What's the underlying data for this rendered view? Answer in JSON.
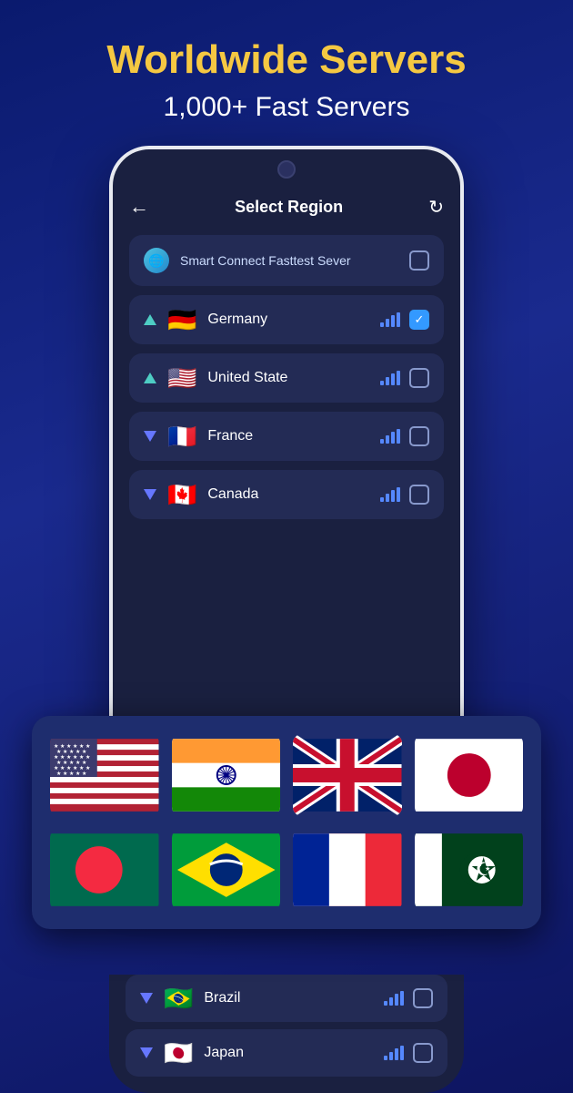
{
  "header": {
    "title_line1": "Worldwide Servers",
    "subtitle": "1,000+ Fast Servers"
  },
  "phone": {
    "screen_title": "Select Region",
    "back_label": "←",
    "refresh_label": "↻"
  },
  "servers": [
    {
      "id": "smart",
      "name": "Smart Connect Fasttest Sever",
      "type": "smart",
      "checked": false
    },
    {
      "id": "germany",
      "name": "Germany",
      "type": "up",
      "flag": "🇩🇪",
      "checked": true
    },
    {
      "id": "usa",
      "name": "United State",
      "type": "up",
      "flag": "🇺🇸",
      "checked": false
    },
    {
      "id": "france",
      "name": "France",
      "type": "down",
      "flag": "🇫🇷",
      "checked": false
    },
    {
      "id": "canada",
      "name": "Canada",
      "type": "down",
      "flag": "🇨🇦",
      "checked": false
    }
  ],
  "bottom_servers": [
    {
      "id": "brazil",
      "name": "Brazil",
      "type": "down",
      "flag": "🇧🇷",
      "checked": false
    },
    {
      "id": "japan",
      "name": "Japan",
      "type": "down",
      "flag": "🇯🇵",
      "checked": false
    }
  ],
  "flags_grid": {
    "row1": [
      "us",
      "india",
      "uk",
      "japan"
    ],
    "row2": [
      "bangladesh",
      "brazil",
      "france",
      "pakistan"
    ]
  },
  "colors": {
    "accent_gold": "#f5c842",
    "bg_dark": "#0a1a6e",
    "item_bg": "#232b55"
  }
}
